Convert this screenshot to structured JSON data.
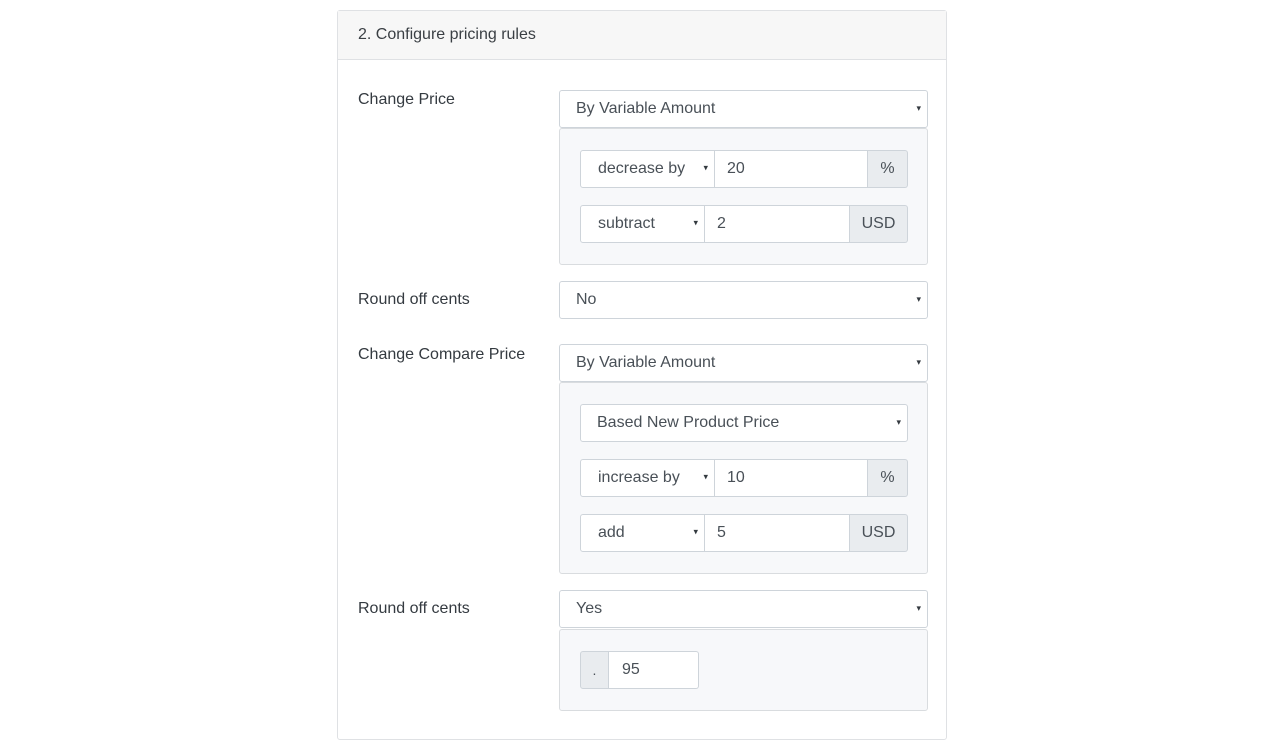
{
  "section": {
    "title": "2. Configure pricing rules"
  },
  "change_price": {
    "label": "Change Price",
    "mode": "By Variable Amount",
    "percent_rule": {
      "operation": "decrease by",
      "value": "20",
      "unit": "%"
    },
    "fixed_rule": {
      "operation": "subtract",
      "value": "2",
      "unit": "USD"
    }
  },
  "round_off_price": {
    "label": "Round off cents",
    "value": "No"
  },
  "change_compare_price": {
    "label": "Change Compare Price",
    "mode": "By Variable Amount",
    "basis": "Based New Product Price",
    "percent_rule": {
      "operation": "increase by",
      "value": "10",
      "unit": "%"
    },
    "fixed_rule": {
      "operation": "add",
      "value": "5",
      "unit": "USD"
    }
  },
  "round_off_compare": {
    "label": "Round off cents",
    "value": "Yes",
    "cents_prefix": ".",
    "cents_value": "95"
  },
  "icons": {
    "caret": "▾"
  }
}
